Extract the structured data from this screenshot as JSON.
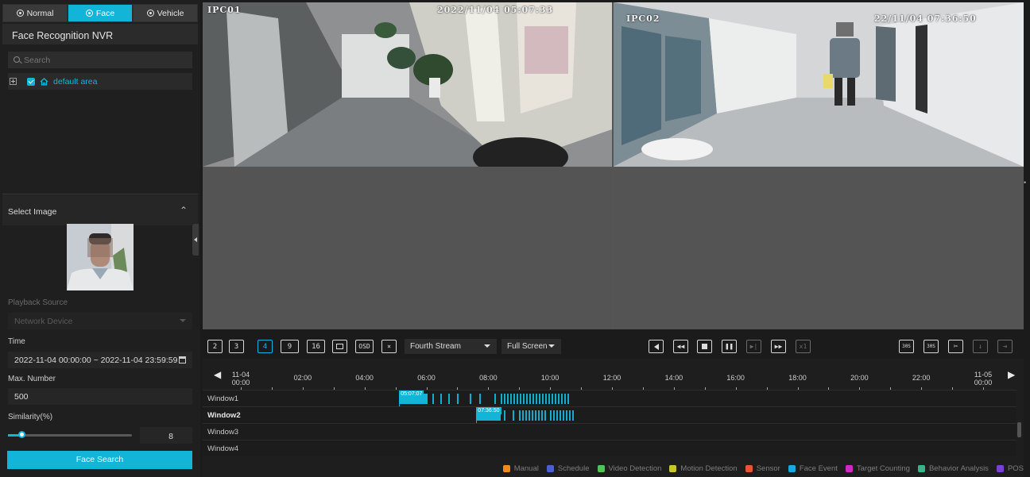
{
  "tabs": [
    {
      "label": "Normal",
      "active": false
    },
    {
      "label": "Face",
      "active": true
    },
    {
      "label": "Vehicle",
      "active": false
    }
  ],
  "app_title": "Face Recognition NVR",
  "search": {
    "placeholder": "Search"
  },
  "tree": {
    "root_label": "default area",
    "checked": true
  },
  "select_image": {
    "title": "Select Image"
  },
  "playback_source": {
    "label": "Playback Source",
    "value": "Network Device"
  },
  "time": {
    "label": "Time",
    "value": "2022-11-04 00:00:00 ~ 2022-11-04 23:59:59"
  },
  "max_number": {
    "label": "Max. Number",
    "value": "500"
  },
  "similarity": {
    "label": "Similarity(%)",
    "value": "8",
    "fraction": 0.08
  },
  "face_search_button": "Face Search",
  "channels": [
    {
      "name": "IPC01",
      "timestamp": "2022/11/04 05:07:33"
    },
    {
      "name": "IPC02",
      "timestamp": "22/11/04 07:36:50"
    }
  ],
  "toolbar": {
    "layouts": [
      "2",
      "3",
      "4",
      "9",
      "16"
    ],
    "active_layout": "4",
    "osd_label": "OSD",
    "stream": "Fourth Stream",
    "screen": "Full Screen",
    "speed": "x1",
    "clip_label_a": "30S",
    "clip_label_b": "30S"
  },
  "timeline": {
    "start_label": {
      "line1": "11-04",
      "line2": "00:00"
    },
    "end_label": {
      "line1": "11-05",
      "line2": "00:00"
    },
    "hours": [
      "02:00",
      "04:00",
      "06:00",
      "08:00",
      "10:00",
      "12:00",
      "14:00",
      "16:00",
      "18:00",
      "20:00",
      "22:00"
    ],
    "windows": [
      {
        "name": "Window1",
        "bold": false,
        "cursor": "05:07:07"
      },
      {
        "name": "Window2",
        "bold": true,
        "cursor": "07:36:50"
      },
      {
        "name": "Window3",
        "bold": false
      },
      {
        "name": "Window4",
        "bold": false
      }
    ]
  },
  "legend": [
    {
      "label": "Manual",
      "color": "#f08a1c"
    },
    {
      "label": "Schedule",
      "color": "#4a5fd0"
    },
    {
      "label": "Video Detection",
      "color": "#56c15b"
    },
    {
      "label": "Motion Detection",
      "color": "#c9c62a"
    },
    {
      "label": "Sensor",
      "color": "#e8552e"
    },
    {
      "label": "Face Event",
      "color": "#1aa9dd"
    },
    {
      "label": "Target Counting",
      "color": "#d129c4"
    },
    {
      "label": "Behavior Analysis",
      "color": "#37b58a"
    },
    {
      "label": "POS",
      "color": "#7a3fd6"
    }
  ]
}
